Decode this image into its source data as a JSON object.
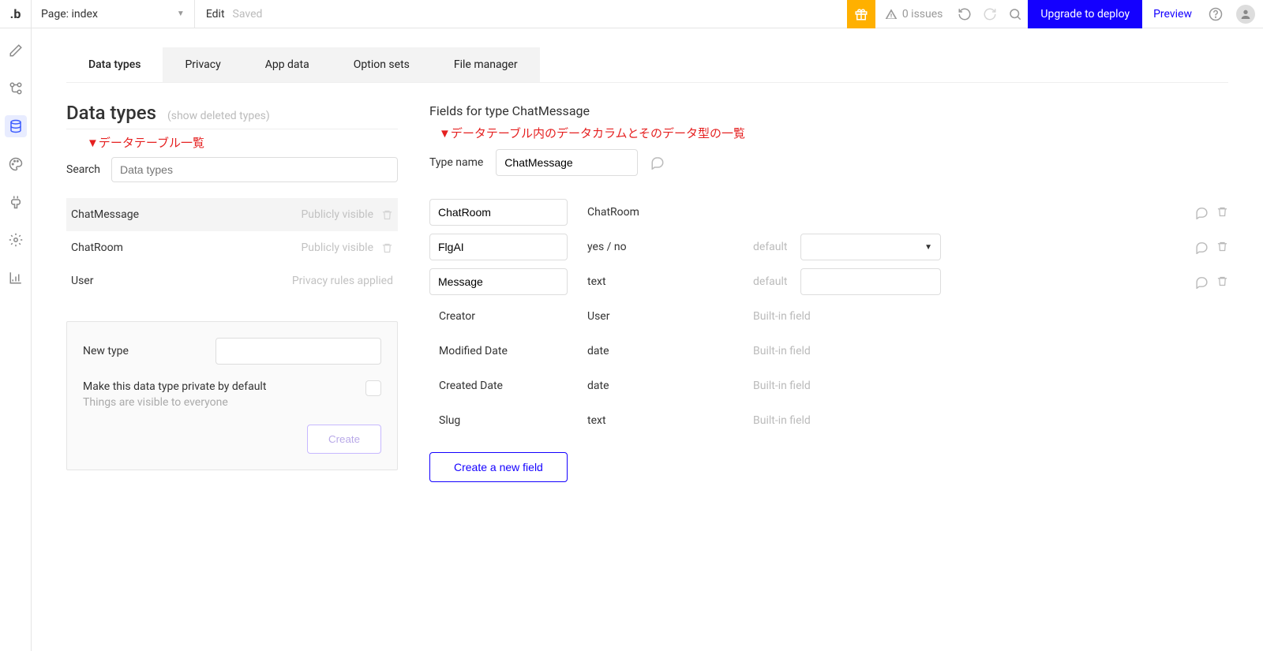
{
  "topbar": {
    "page_label": "Page: index",
    "edit": "Edit",
    "saved": "Saved",
    "issues": "0 issues",
    "upgrade": "Upgrade to deploy",
    "preview": "Preview"
  },
  "tabs": [
    "Data types",
    "Privacy",
    "App data",
    "Option sets",
    "File manager"
  ],
  "left": {
    "heading": "Data types",
    "show_deleted": "(show deleted types)",
    "annotation": "▼データテーブル一覧",
    "search_label": "Search",
    "search_placeholder": "Data types",
    "types": [
      {
        "name": "ChatMessage",
        "status": "Publicly visible",
        "selected": true,
        "trash": true
      },
      {
        "name": "ChatRoom",
        "status": "Publicly visible",
        "selected": false,
        "trash": true
      },
      {
        "name": "User",
        "status": "Privacy rules applied",
        "selected": false,
        "trash": false
      }
    ],
    "new_type_label": "New type",
    "private_label": "Make this data type private by default",
    "private_hint": "Things are visible to everyone",
    "create_btn": "Create"
  },
  "right": {
    "heading": "Fields for type ChatMessage",
    "annotation": "▼データテーブル内のデータカラムとそのデータ型の一覧",
    "type_name_label": "Type name",
    "type_name_value": "ChatMessage",
    "fields": [
      {
        "name": "ChatRoom",
        "type": "ChatRoom",
        "editable": true,
        "default_kind": "none"
      },
      {
        "name": "FlgAI",
        "type": "yes / no",
        "editable": true,
        "default_kind": "select"
      },
      {
        "name": "Message",
        "type": "text",
        "editable": true,
        "default_kind": "text"
      },
      {
        "name": "Creator",
        "type": "User",
        "editable": false
      },
      {
        "name": "Modified Date",
        "type": "date",
        "editable": false
      },
      {
        "name": "Created Date",
        "type": "date",
        "editable": false
      },
      {
        "name": "Slug",
        "type": "text",
        "editable": false
      }
    ],
    "default_label": "default",
    "builtin_label": "Built-in field",
    "create_field_btn": "Create a new field"
  }
}
